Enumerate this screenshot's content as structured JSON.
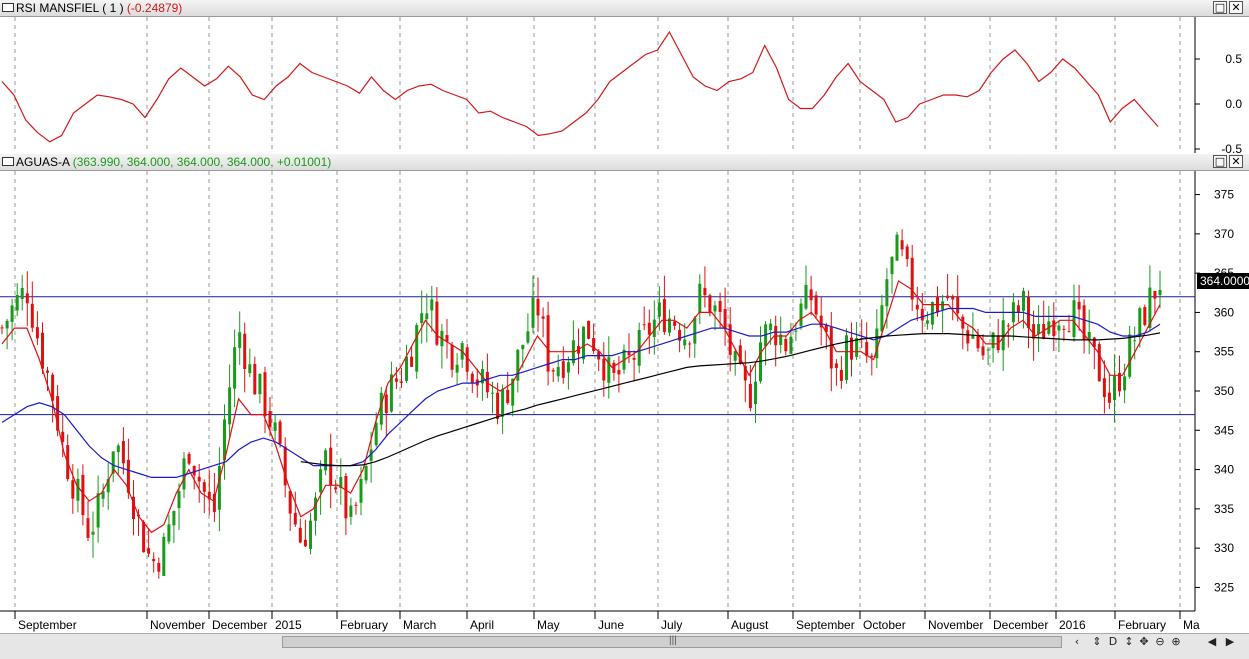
{
  "rsi_panel": {
    "label": "RSI MANSFIEL ( 1 )",
    "value": "(-0.24879)"
  },
  "price_panel": {
    "label": "AGUAS-A",
    "values": "(363.990, 364.000, 364.000, 364.000, +0.01001)"
  },
  "window_buttons": {
    "maximize": "□",
    "close": "✕"
  },
  "last_price_tag": "364.0000",
  "scroll_grip": "|||",
  "nav_icons": [
    "scroll-left-icon",
    "calendar-icon",
    "day-icon",
    "arrows-icon",
    "move-icon",
    "zoom-out-icon",
    "zoom-in-icon",
    "prev-icon",
    "next-icon"
  ],
  "nav_symbols": [
    "‹",
    "⇕",
    "D",
    "↕",
    "✥",
    "⊖",
    "⊕",
    "◀",
    "▶"
  ],
  "colors": {
    "rsi": "#d21919",
    "up": "#1a9a1a",
    "down": "#e01010",
    "ma_short": "#e01010",
    "ma_mid": "#1a1acc",
    "ma_long": "#000000",
    "levels": "#1a1aa0"
  },
  "chart_data": [
    {
      "type": "line",
      "title": "RSI MANSFIEL ( 1 )",
      "ylim": [
        -0.5,
        0.9
      ],
      "yticks": [
        "0.5",
        "0.0",
        "-0.5"
      ],
      "ytick_values": [
        0.5,
        0.0,
        -0.5
      ],
      "series": [
        {
          "name": "RSI MANSFIEL ( 1 )",
          "values": [
            0.25,
            0.1,
            -0.18,
            -0.32,
            -0.42,
            -0.35,
            -0.1,
            0.0,
            0.1,
            0.08,
            0.05,
            0.0,
            -0.15,
            0.05,
            0.28,
            0.4,
            0.3,
            0.2,
            0.28,
            0.42,
            0.3,
            0.1,
            0.05,
            0.2,
            0.3,
            0.45,
            0.35,
            0.3,
            0.25,
            0.2,
            0.12,
            0.3,
            0.15,
            0.05,
            0.15,
            0.2,
            0.22,
            0.15,
            0.1,
            0.05,
            -0.1,
            -0.08,
            -0.15,
            -0.2,
            -0.25,
            -0.35,
            -0.33,
            -0.3,
            -0.2,
            -0.1,
            0.05,
            0.25,
            0.35,
            0.45,
            0.55,
            0.6,
            0.8,
            0.55,
            0.3,
            0.2,
            0.15,
            0.25,
            0.28,
            0.35,
            0.65,
            0.4,
            0.05,
            -0.05,
            -0.05,
            0.1,
            0.3,
            0.45,
            0.25,
            0.15,
            0.05,
            -0.2,
            -0.15,
            0.0,
            0.05,
            0.1,
            0.1,
            0.08,
            0.15,
            0.35,
            0.5,
            0.6,
            0.45,
            0.25,
            0.35,
            0.5,
            0.4,
            0.25,
            0.1,
            -0.2,
            -0.05,
            0.05,
            -0.1,
            -0.25
          ]
        }
      ],
      "xlabels": [
        "September",
        "November",
        "December",
        "2015",
        "February",
        "March",
        "April",
        "May",
        "June",
        "July",
        "August",
        "September",
        "October",
        "November",
        "December",
        "2016",
        "February",
        "Ma"
      ]
    },
    {
      "type": "candlestick",
      "title": "AGUAS-A",
      "ylim": [
        322,
        378
      ],
      "yticks": [
        "375",
        "370",
        "365",
        "360",
        "355",
        "350",
        "345",
        "340",
        "335",
        "330",
        "325"
      ],
      "ytick_values": [
        375,
        370,
        365,
        360,
        355,
        350,
        345,
        340,
        335,
        330,
        325
      ],
      "xlabels": [
        "September",
        "November",
        "December",
        "2015",
        "February",
        "March",
        "April",
        "May",
        "June",
        "July",
        "August",
        "September",
        "October",
        "November",
        "December",
        "2016",
        "February",
        "Ma"
      ],
      "horizontal_levels": [
        362,
        347
      ],
      "last_price": 364.0,
      "close_path": [
        358,
        361,
        363,
        356,
        350,
        342,
        337,
        332,
        336,
        344,
        340,
        333,
        328,
        330,
        336,
        343,
        338,
        334,
        348,
        358,
        352,
        349,
        344,
        336,
        331,
        334,
        341,
        338,
        333,
        338,
        346,
        350,
        352,
        356,
        362,
        358,
        355,
        356,
        352,
        350,
        348,
        352,
        357,
        361,
        353,
        354,
        356,
        358,
        355,
        351,
        353,
        355,
        358,
        360,
        359,
        357,
        362,
        361,
        358,
        352,
        349,
        357,
        358,
        356,
        360,
        362,
        357,
        352,
        356,
        355,
        353,
        364,
        368,
        363,
        360,
        361,
        362,
        358,
        357,
        354,
        357,
        359,
        361,
        356,
        359,
        360,
        360,
        356,
        353,
        349,
        353,
        357,
        361,
        364
      ],
      "series": [
        {
          "name": "MA short",
          "color": "#e01010",
          "values": [
            356,
            358,
            358,
            354,
            349,
            342,
            338,
            336,
            337,
            340,
            338,
            334,
            332,
            333,
            337,
            340,
            337,
            336,
            342,
            349,
            347,
            347,
            343,
            338,
            334,
            335,
            338,
            338,
            337,
            340,
            346,
            351,
            353,
            356,
            359,
            357,
            356,
            355,
            353,
            351,
            350,
            351,
            354,
            357,
            355,
            355,
            355,
            356,
            355,
            353,
            354,
            355,
            357,
            359,
            359,
            358,
            360,
            360,
            358,
            355,
            352,
            355,
            357,
            357,
            359,
            360,
            358,
            355,
            355,
            355,
            354,
            359,
            364,
            363,
            361,
            361,
            361,
            359,
            358,
            356,
            356,
            358,
            359,
            357,
            358,
            359,
            359,
            357,
            355,
            352,
            352,
            355,
            358,
            361
          ]
        },
        {
          "name": "MA mid",
          "color": "#1a1acc",
          "values": [
            346,
            347,
            348,
            348.5,
            348,
            347,
            345,
            343,
            341.5,
            340.5,
            340,
            339.5,
            339,
            339,
            339,
            339.5,
            340,
            340.5,
            341,
            342.5,
            343.5,
            344,
            343.5,
            342.5,
            341.5,
            340.5,
            340.5,
            340.5,
            340.5,
            341,
            342.5,
            344.5,
            346,
            347.5,
            349,
            350,
            350.5,
            351,
            351,
            351.5,
            352,
            352,
            352.5,
            353,
            353.5,
            354,
            354,
            354.5,
            354.5,
            354.5,
            355,
            355,
            355.5,
            356,
            356.5,
            357,
            357.5,
            358,
            358,
            357.5,
            357,
            357,
            357.5,
            357.5,
            358,
            358.5,
            358.5,
            358,
            357.5,
            357,
            356.5,
            357,
            358,
            359,
            359.5,
            360,
            360.5,
            360.5,
            360.5,
            360,
            360,
            360,
            360,
            359.5,
            359.5,
            359.5,
            359.5,
            359,
            358.5,
            357.5,
            357,
            357,
            357.5,
            358.5
          ]
        },
        {
          "name": "MA long",
          "color": "#000000",
          "values": [
            null,
            null,
            null,
            null,
            null,
            null,
            null,
            null,
            null,
            null,
            null,
            null,
            null,
            null,
            null,
            null,
            null,
            null,
            null,
            null,
            null,
            null,
            null,
            null,
            341,
            340.8,
            340.6,
            340.5,
            340.5,
            340.6,
            341,
            341.6,
            342.3,
            343,
            343.7,
            344.3,
            344.8,
            345.3,
            345.8,
            346.3,
            346.8,
            347.3,
            347.7,
            348.2,
            348.6,
            349,
            349.4,
            349.8,
            350.2,
            350.6,
            351,
            351.4,
            351.8,
            352.2,
            352.6,
            353,
            353.2,
            353.3,
            353.4,
            353.5,
            353.6,
            353.8,
            354.1,
            354.4,
            354.8,
            355.2,
            355.6,
            356,
            356.3,
            356.6,
            356.8,
            357,
            357.1,
            357.2,
            357.3,
            357.3,
            357.3,
            357.2,
            357.1,
            357,
            357,
            357,
            356.9,
            356.8,
            356.7,
            356.6,
            356.5,
            356.5,
            356.5,
            356.6,
            356.7,
            356.9,
            357.1,
            357.4
          ]
        }
      ]
    }
  ]
}
